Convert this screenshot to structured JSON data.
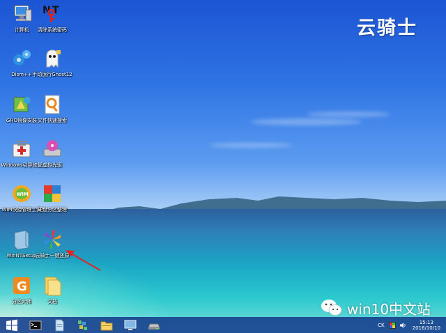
{
  "desktop": {
    "icons": [
      {
        "label": "计算机"
      },
      {
        "label": "清除系统密码"
      },
      {
        "label": "Dism++"
      },
      {
        "label": "手动运行Ghost12"
      },
      {
        "label": "GHO镜像安装"
      },
      {
        "label": "文件快速搜索"
      },
      {
        "label": "Windows引导修复"
      },
      {
        "label": "虚拟光驱"
      },
      {
        "label": "WIM快捷管理工具"
      },
      {
        "label": "硬盘分区整理"
      },
      {
        "label": "WinNTSetup"
      },
      {
        "label": "云骑士一键还原"
      },
      {
        "label": "分区大师"
      },
      {
        "label": "文档"
      }
    ]
  },
  "brand": {
    "text": "云骑士"
  },
  "watermark": {
    "text": "win10中文站",
    "icon": "wechat-icon"
  },
  "taskbar": {
    "buttons": [
      {
        "icon": "windows-start-icon"
      },
      {
        "icon": "command-prompt-icon"
      },
      {
        "icon": "file-icon"
      },
      {
        "icon": "network-icon"
      },
      {
        "icon": "folder-icon"
      },
      {
        "icon": "monitor-icon"
      },
      {
        "icon": "drive-icon"
      }
    ],
    "tray": {
      "input_indicator": "CK",
      "time": "15:13",
      "date": "2016/10/10"
    }
  },
  "colors": {
    "taskbar": "#1a3c8c",
    "sky": "#2f74e4",
    "sea": "#1aa6c4"
  }
}
